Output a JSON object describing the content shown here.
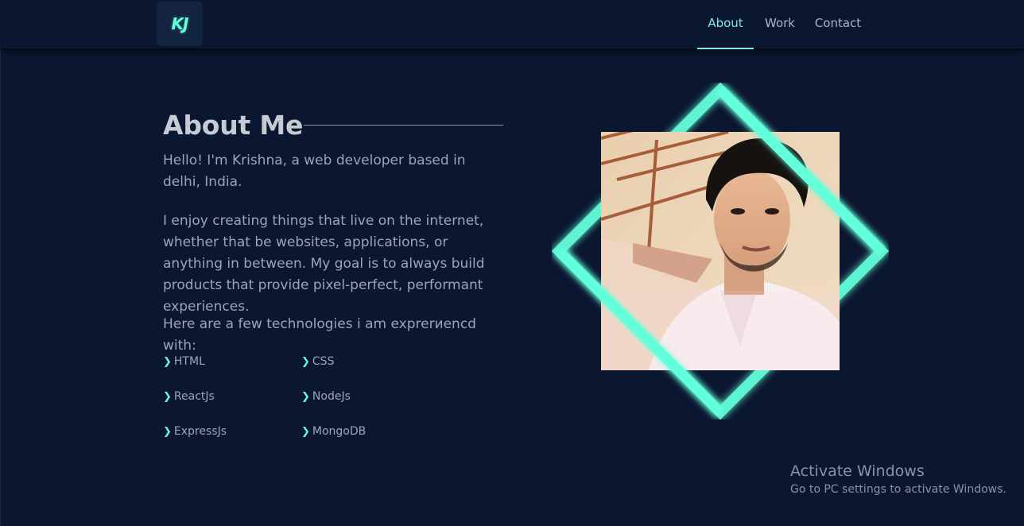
{
  "logo": {
    "text": "KJ"
  },
  "nav": {
    "items": [
      {
        "label": "About",
        "active": true
      },
      {
        "label": "Work",
        "active": false
      },
      {
        "label": "Contact",
        "active": false
      }
    ]
  },
  "about": {
    "title": "About Me",
    "paragraphs": [
      "Hello! I'm Krishna, a web developer based in delhi, India.",
      "I enjoy creating things that live on the internet, whether that be websites, applications, or anything in between. My goal is to always build products that provide pixel-perfect, performant experiences.",
      "Here are a few technologies i am exprerиencd with:"
    ],
    "technologies": [
      "HTML",
      "CSS",
      "ReactJs",
      "NodeJs",
      "ExpressJs",
      "MongoDB"
    ],
    "bullet_icon": "chevron-right-icon"
  },
  "profile_photo": {
    "icon": "profile-photo",
    "frame_color": "#64ffda"
  },
  "windows_watermark": {
    "title": "Activate Windows",
    "subtitle": "Go to PC settings to activate Windows."
  },
  "colors": {
    "background": "#0b1730",
    "accent": "#64ffda",
    "nav_active": "#80e8ea",
    "text": "#9aa5bd",
    "heading": "#c5cad3"
  }
}
